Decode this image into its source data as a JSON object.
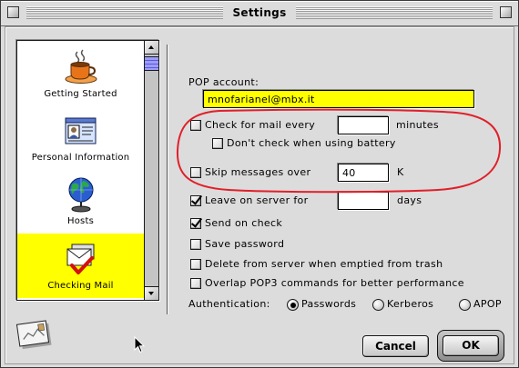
{
  "window": {
    "title": "Settings"
  },
  "sidebar": {
    "items": [
      {
        "label": "Getting Started",
        "icon": "coffee-cup-icon",
        "selected": false
      },
      {
        "label": "Personal Information",
        "icon": "id-card-icon",
        "selected": false
      },
      {
        "label": "Hosts",
        "icon": "globe-icon",
        "selected": false
      },
      {
        "label": "Checking Mail",
        "icon": "mail-check-icon",
        "selected": true
      }
    ]
  },
  "form": {
    "pop_account": {
      "label": "POP account:",
      "value": "mnofarianel@mbx.it"
    },
    "check_every": {
      "label": "Check for mail every",
      "value": "",
      "unit": "minutes",
      "checked": false
    },
    "no_battery": {
      "label": "Don't check when using battery",
      "checked": false
    },
    "skip_over": {
      "label": "Skip messages over",
      "value": "40",
      "unit": "K",
      "checked": false
    },
    "leave_on_server": {
      "label": "Leave on server for",
      "value": "",
      "unit": "days",
      "checked": true
    },
    "send_on_check": {
      "label": "Send on check",
      "checked": true
    },
    "save_password": {
      "label": "Save password",
      "checked": false
    },
    "delete_from_server": {
      "label": "Delete from server when emptied from trash",
      "checked": false
    },
    "overlap_pop3": {
      "label": "Overlap POP3 commands for better performance",
      "checked": false
    },
    "authentication": {
      "label": "Authentication:",
      "options": [
        {
          "label": "Passwords",
          "selected": true
        },
        {
          "label": "Kerberos",
          "selected": false
        },
        {
          "label": "APOP",
          "selected": false
        }
      ]
    }
  },
  "buttons": {
    "cancel": "Cancel",
    "ok": "OK"
  },
  "decorations": {
    "corner_icon": "postcard-icon",
    "pointer": "arrow-cursor-icon",
    "annotation": "red-ellipse"
  },
  "colors": {
    "selection_highlight": "#ffff00",
    "annotation": "#e0202a",
    "scroll_thumb": "#9c9cff"
  }
}
